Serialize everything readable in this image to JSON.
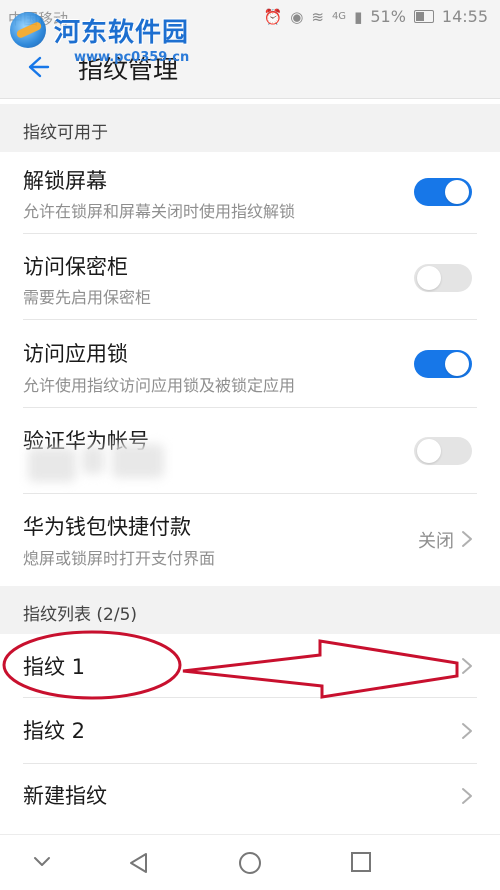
{
  "status_bar": {
    "carrier": "中国移动",
    "network": "4G",
    "battery": "51%",
    "time": "14:55"
  },
  "watermark": {
    "title": "河东软件园",
    "url": "www.pc0359.cn"
  },
  "header": {
    "title": "指纹管理"
  },
  "sections": {
    "usage_title": "指纹可用于",
    "list_title": "指纹列表 (2/5)"
  },
  "settings": [
    {
      "title": "解锁屏幕",
      "subtitle": "允许在锁屏和屏幕关闭时使用指纹解锁",
      "toggle": "on"
    },
    {
      "title": "访问保密柜",
      "subtitle": "需要先启用保密柜",
      "toggle": "off"
    },
    {
      "title": "访问应用锁",
      "subtitle": "允许使用指纹访问应用锁及被锁定应用",
      "toggle": "on"
    },
    {
      "title": "验证华为帐号",
      "subtitle": "",
      "toggle": "off"
    },
    {
      "title": "华为钱包快捷付款",
      "subtitle": "熄屏或锁屏时打开支付界面",
      "value": "关闭"
    }
  ],
  "fingerprints": [
    {
      "label": "指纹 1"
    },
    {
      "label": "指纹 2"
    },
    {
      "label": "新建指纹"
    }
  ],
  "colors": {
    "accent": "#1777e8",
    "annotation_red": "#c8102e"
  },
  "icons": {
    "back": "arrow-left-icon",
    "chevron": "chevron-right-icon",
    "nav_down": "chevron-down-icon",
    "nav_back": "triangle-back-icon",
    "nav_home": "circle-home-icon",
    "nav_recent": "square-recent-icon"
  }
}
